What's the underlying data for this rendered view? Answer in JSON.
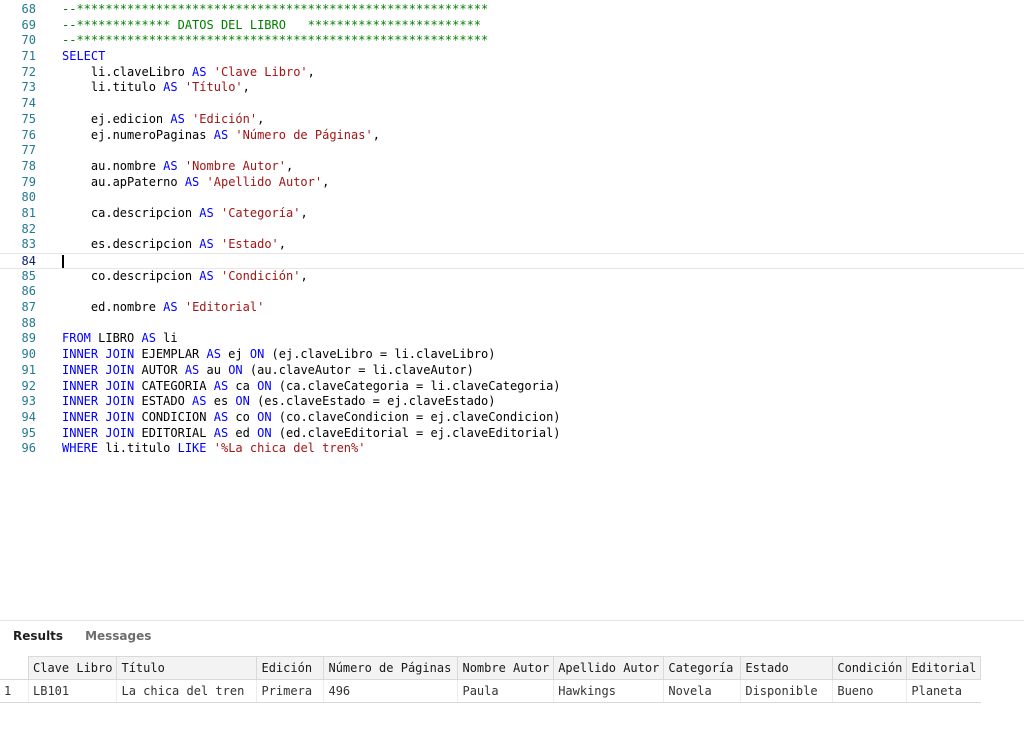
{
  "editor": {
    "first_line": 68,
    "current_line": 84,
    "lines": [
      [
        [
          "cm",
          "--*********************************************************"
        ]
      ],
      [
        [
          "cm",
          "--************* DATOS DEL LIBRO   ************************"
        ]
      ],
      [
        [
          "cm",
          "--*********************************************************"
        ]
      ],
      [
        [
          "kw",
          "SELECT"
        ]
      ],
      [
        [
          "pl",
          "    li.claveLibro "
        ],
        [
          "kw",
          "AS"
        ],
        [
          "pl",
          " "
        ],
        [
          "str",
          "'Clave Libro'"
        ],
        [
          "pl",
          ","
        ]
      ],
      [
        [
          "pl",
          "    li.titulo "
        ],
        [
          "kw",
          "AS"
        ],
        [
          "pl",
          " "
        ],
        [
          "str",
          "'Título'"
        ],
        [
          "pl",
          ","
        ]
      ],
      [],
      [
        [
          "pl",
          "    ej.edicion "
        ],
        [
          "kw",
          "AS"
        ],
        [
          "pl",
          " "
        ],
        [
          "str",
          "'Edición'"
        ],
        [
          "pl",
          ","
        ]
      ],
      [
        [
          "pl",
          "    ej.numeroPaginas "
        ],
        [
          "kw",
          "AS"
        ],
        [
          "pl",
          " "
        ],
        [
          "str",
          "'Número de Páginas'"
        ],
        [
          "pl",
          ","
        ]
      ],
      [],
      [
        [
          "pl",
          "    au.nombre "
        ],
        [
          "kw",
          "AS"
        ],
        [
          "pl",
          " "
        ],
        [
          "str",
          "'Nombre Autor'"
        ],
        [
          "pl",
          ","
        ]
      ],
      [
        [
          "pl",
          "    au.apPaterno "
        ],
        [
          "kw",
          "AS"
        ],
        [
          "pl",
          " "
        ],
        [
          "str",
          "'Apellido Autor'"
        ],
        [
          "pl",
          ","
        ]
      ],
      [],
      [
        [
          "pl",
          "    ca.descripcion "
        ],
        [
          "kw",
          "AS"
        ],
        [
          "pl",
          " "
        ],
        [
          "str",
          "'Categoría'"
        ],
        [
          "pl",
          ","
        ]
      ],
      [],
      [
        [
          "pl",
          "    es.descripcion "
        ],
        [
          "kw",
          "AS"
        ],
        [
          "pl",
          " "
        ],
        [
          "str",
          "'Estado'"
        ],
        [
          "pl",
          ","
        ]
      ],
      [],
      [
        [
          "pl",
          "    co.descripcion "
        ],
        [
          "kw",
          "AS"
        ],
        [
          "pl",
          " "
        ],
        [
          "str",
          "'Condición'"
        ],
        [
          "pl",
          ","
        ]
      ],
      [],
      [
        [
          "pl",
          "    ed.nombre "
        ],
        [
          "kw",
          "AS"
        ],
        [
          "pl",
          " "
        ],
        [
          "str",
          "'Editorial'"
        ]
      ],
      [],
      [
        [
          "kw",
          "FROM"
        ],
        [
          "pl",
          " LIBRO "
        ],
        [
          "kw",
          "AS"
        ],
        [
          "pl",
          " li"
        ]
      ],
      [
        [
          "kw",
          "INNER JOIN"
        ],
        [
          "pl",
          " EJEMPLAR "
        ],
        [
          "kw",
          "AS"
        ],
        [
          "pl",
          " ej "
        ],
        [
          "kw",
          "ON"
        ],
        [
          "pl",
          " (ej.claveLibro = li.claveLibro)"
        ]
      ],
      [
        [
          "kw",
          "INNER JOIN"
        ],
        [
          "pl",
          " AUTOR "
        ],
        [
          "kw",
          "AS"
        ],
        [
          "pl",
          " au "
        ],
        [
          "kw",
          "ON"
        ],
        [
          "pl",
          " (au.claveAutor = li.claveAutor)"
        ]
      ],
      [
        [
          "kw",
          "INNER JOIN"
        ],
        [
          "pl",
          " CATEGORIA "
        ],
        [
          "kw",
          "AS"
        ],
        [
          "pl",
          " ca "
        ],
        [
          "kw",
          "ON"
        ],
        [
          "pl",
          " (ca.claveCategoria = li.claveCategoria)"
        ]
      ],
      [
        [
          "kw",
          "INNER JOIN"
        ],
        [
          "pl",
          " ESTADO "
        ],
        [
          "kw",
          "AS"
        ],
        [
          "pl",
          " es "
        ],
        [
          "kw",
          "ON"
        ],
        [
          "pl",
          " (es.claveEstado = ej.claveEstado)"
        ]
      ],
      [
        [
          "kw",
          "INNER JOIN"
        ],
        [
          "pl",
          " CONDICION "
        ],
        [
          "kw",
          "AS"
        ],
        [
          "pl",
          " co "
        ],
        [
          "kw",
          "ON"
        ],
        [
          "pl",
          " (co.claveCondicion = ej.claveCondicion)"
        ]
      ],
      [
        [
          "kw",
          "INNER JOIN"
        ],
        [
          "pl",
          " EDITORIAL "
        ],
        [
          "kw",
          "AS"
        ],
        [
          "pl",
          " ed "
        ],
        [
          "kw",
          "ON"
        ],
        [
          "pl",
          " (ed.claveEditorial = ej.claveEditorial)"
        ]
      ],
      [
        [
          "kw",
          "WHERE"
        ],
        [
          "pl",
          " li.titulo "
        ],
        [
          "kw",
          "LIKE"
        ],
        [
          "pl",
          " "
        ],
        [
          "str",
          "'%La chica del tren%'"
        ]
      ]
    ]
  },
  "results": {
    "tabs": [
      {
        "label": "Results",
        "active": true
      },
      {
        "label": "Messages",
        "active": false
      }
    ],
    "columns": [
      "Clave Libro",
      "Título",
      "Edición",
      "Número de Páginas",
      "Nombre Autor",
      "Apellido Autor",
      "Categoría",
      "Estado",
      "Condición",
      "Editorial"
    ],
    "rows": [
      {
        "num": "1",
        "cells": [
          "LB101",
          "La chica del tren",
          "Primera",
          "496",
          "Paula",
          "Hawkings",
          "Novela",
          "Disponible",
          "Bueno",
          "Planeta"
        ]
      }
    ]
  }
}
